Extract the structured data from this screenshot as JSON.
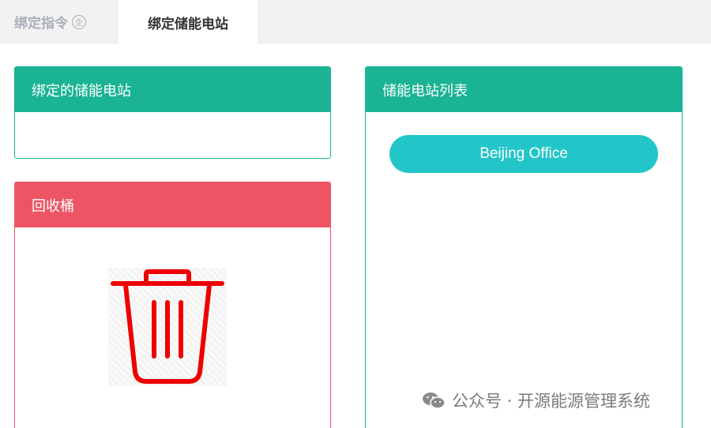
{
  "tabs": {
    "inactive_label": "绑定指令",
    "inactive_badge": "企",
    "active_label": "绑定储能电站"
  },
  "bound_panel": {
    "title": "绑定的储能电站"
  },
  "recycle_panel": {
    "title": "回收桶",
    "icon": "trash-icon"
  },
  "station_list": {
    "title": "储能电站列表",
    "stations": [
      "Beijing Office"
    ]
  },
  "watermark": {
    "text": "公众号 · 开源能源管理系统",
    "icon": "wechat-icon"
  },
  "colors": {
    "green": "#1ab394",
    "red": "#ed5565",
    "teal": "#23c6c8",
    "trash": "#ee0000"
  }
}
